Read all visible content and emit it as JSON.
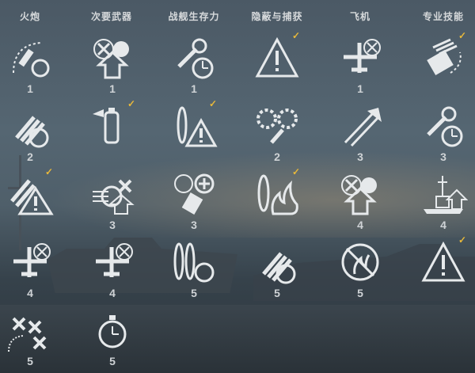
{
  "headers": [
    "火炮",
    "次要武器",
    "战舰生存力",
    "隐蔽与捕获",
    "飞机",
    "专业技能"
  ],
  "skills": [
    {
      "name": "shell-arc-skill-icon",
      "tier": "1",
      "checked": false,
      "glyph": "arc"
    },
    {
      "name": "aa-gun-skill-icon",
      "tier": "1",
      "checked": false,
      "glyph": "aa"
    },
    {
      "name": "wrench-timer-skill-icon",
      "tier": "1",
      "checked": false,
      "glyph": "wrench"
    },
    {
      "name": "warning-skill-icon",
      "tier": "",
      "checked": true,
      "glyph": "warn"
    },
    {
      "name": "plane-target-skill-icon",
      "tier": "1",
      "checked": false,
      "glyph": "plane"
    },
    {
      "name": "turret-rotate-skill-icon",
      "tier": "",
      "checked": true,
      "glyph": "turret"
    },
    {
      "name": "shell-timer-skill-icon",
      "tier": "2",
      "checked": false,
      "glyph": "shells"
    },
    {
      "name": "extinguisher-skill-icon",
      "tier": "",
      "checked": true,
      "glyph": "ext"
    },
    {
      "name": "torpedo-warning-skill-icon",
      "tier": "",
      "checked": true,
      "glyph": "torpwarn"
    },
    {
      "name": "gears-wrench-skill-icon",
      "tier": "2",
      "checked": false,
      "glyph": "gears"
    },
    {
      "name": "range-arrow-skill-icon",
      "tier": "3",
      "checked": false,
      "glyph": "range"
    },
    {
      "name": "wrench-clock-skill-icon",
      "tier": "3",
      "checked": false,
      "glyph": "wrench"
    },
    {
      "name": "shells-warning-skill-icon",
      "tier": "",
      "checked": true,
      "glyph": "shellwarn"
    },
    {
      "name": "crosshair-upgrade-skill-icon",
      "tier": "3",
      "checked": false,
      "glyph": "cross"
    },
    {
      "name": "aa-plus-skill-icon",
      "tier": "3",
      "checked": false,
      "glyph": "aaplus"
    },
    {
      "name": "fire-skill-icon",
      "tier": "",
      "checked": true,
      "glyph": "fire"
    },
    {
      "name": "aa-upgrade-skill-icon",
      "tier": "4",
      "checked": false,
      "glyph": "aa"
    },
    {
      "name": "ship-upgrade-skill-icon",
      "tier": "4",
      "checked": false,
      "glyph": "ship"
    },
    {
      "name": "plane-timer-skill-icon",
      "tier": "4",
      "checked": false,
      "glyph": "plane"
    },
    {
      "name": "plane-crosshair-skill-icon",
      "tier": "4",
      "checked": false,
      "glyph": "plane"
    },
    {
      "name": "torpedo-timer-skill-icon",
      "tier": "5",
      "checked": false,
      "glyph": "torps"
    },
    {
      "name": "shells-upgrade-skill-icon",
      "tier": "5",
      "checked": false,
      "glyph": "shells"
    },
    {
      "name": "no-fire-skill-icon",
      "tier": "5",
      "checked": false,
      "glyph": "nofire"
    },
    {
      "name": "warning-down-skill-icon",
      "tier": "",
      "checked": true,
      "glyph": "warn"
    },
    {
      "name": "squadron-skill-icon",
      "tier": "5",
      "checked": false,
      "glyph": "squad"
    },
    {
      "name": "stopwatch-skill-icon",
      "tier": "5",
      "checked": false,
      "glyph": "watch"
    }
  ],
  "check_glyph": "✓",
  "colors": {
    "icon": "#e6e9eb",
    "check": "#e8b83a",
    "header": "#d6d9db"
  }
}
